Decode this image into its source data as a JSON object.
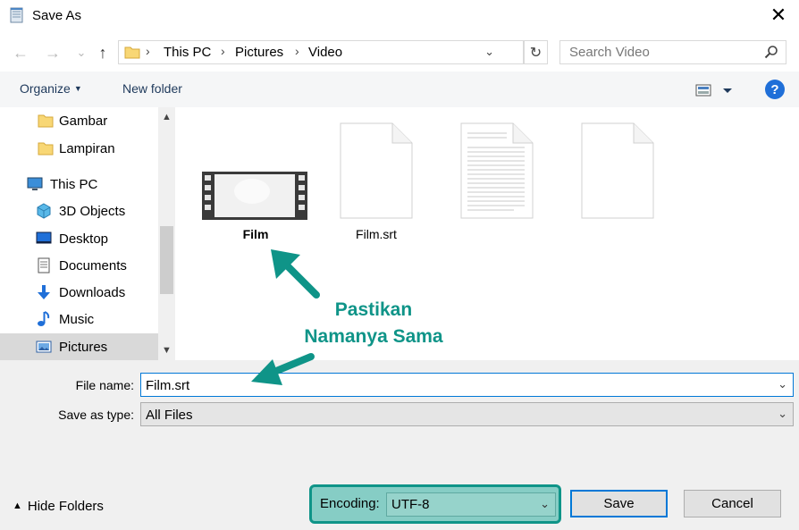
{
  "window": {
    "title": "Save As",
    "close_glyph": "✕"
  },
  "toolbar": {
    "back_glyph": "←",
    "forward_glyph": "→",
    "recent_glyph": "⌄",
    "up_glyph": "↑",
    "breadcrumb": [
      "This PC",
      "Pictures",
      "Video"
    ],
    "breadcrumb_sep": "›",
    "search_placeholder": "Search Video",
    "refresh_glyph": "↻"
  },
  "commandbar": {
    "organize_label": "Organize",
    "new_folder_label": "New folder",
    "help_label": "?"
  },
  "navpane": {
    "items": [
      {
        "label": "Gambar",
        "icon": "folder-icon"
      },
      {
        "label": "Lampiran",
        "icon": "folder-icon"
      },
      {
        "label": "This PC",
        "icon": "computer-icon"
      },
      {
        "label": "3D Objects",
        "icon": "cube-icon"
      },
      {
        "label": "Desktop",
        "icon": "desktop-icon"
      },
      {
        "label": "Documents",
        "icon": "document-icon"
      },
      {
        "label": "Downloads",
        "icon": "download-icon"
      },
      {
        "label": "Music",
        "icon": "music-icon"
      },
      {
        "label": "Pictures",
        "icon": "pictures-icon"
      }
    ],
    "selected_index": 8
  },
  "files": [
    {
      "name": "Film",
      "icon": "video-thumbnail-icon"
    },
    {
      "name": "Film.srt",
      "icon": "blank-file-icon"
    },
    {
      "name": "",
      "icon": "text-file-icon"
    },
    {
      "name": "",
      "icon": "blank-file-icon"
    }
  ],
  "form": {
    "file_name_label": "File name:",
    "file_name_value": "Film.srt",
    "save_type_label": "Save as type:",
    "save_type_value": "All Files",
    "hide_folders_label": "Hide Folders",
    "encoding_label": "Encoding:",
    "encoding_value": "UTF-8",
    "save_label": "Save",
    "cancel_label": "Cancel"
  },
  "annotation": {
    "line1": "Pastikan",
    "line2": "Namanya Sama",
    "color": "#0f9488"
  }
}
